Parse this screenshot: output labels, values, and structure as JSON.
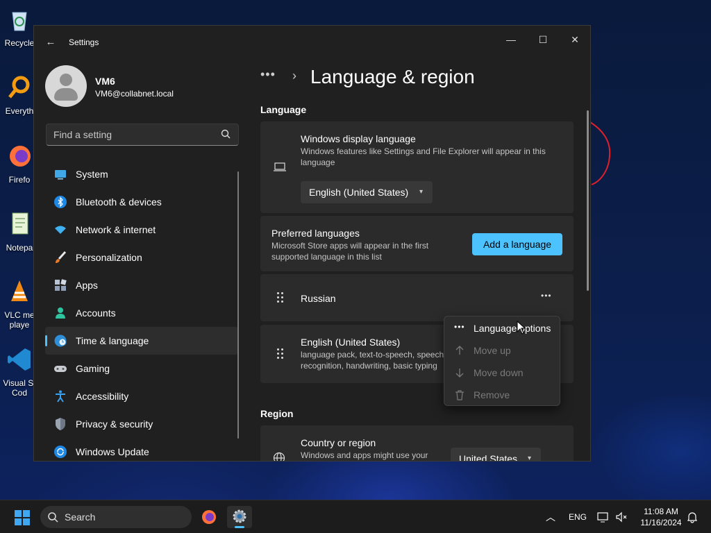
{
  "desktop": {
    "icons": [
      {
        "label": "Recycle"
      },
      {
        "label": "Everyth"
      },
      {
        "label": "Firefo"
      },
      {
        "label": "Notepa"
      },
      {
        "label": "VLC me"
      },
      {
        "label": "playe"
      },
      {
        "label": "Visual St"
      },
      {
        "label": "Cod"
      }
    ]
  },
  "window": {
    "title": "Settings",
    "controls": {
      "minimize": "—",
      "maximize": "☐",
      "close": "✕"
    }
  },
  "profile": {
    "name": "VM6",
    "email": "VM6@collabnet.local"
  },
  "search": {
    "placeholder": "Find a setting"
  },
  "sidebar": {
    "items": [
      {
        "label": "System",
        "icon": "system-icon"
      },
      {
        "label": "Bluetooth & devices",
        "icon": "bluetooth-icon"
      },
      {
        "label": "Network & internet",
        "icon": "network-icon"
      },
      {
        "label": "Personalization",
        "icon": "brush-icon"
      },
      {
        "label": "Apps",
        "icon": "apps-icon"
      },
      {
        "label": "Accounts",
        "icon": "accounts-icon"
      },
      {
        "label": "Time & language",
        "icon": "globe-icon",
        "active": true
      },
      {
        "label": "Gaming",
        "icon": "gamepad-icon"
      },
      {
        "label": "Accessibility",
        "icon": "accessibility-icon"
      },
      {
        "label": "Privacy & security",
        "icon": "shield-icon"
      },
      {
        "label": "Windows Update",
        "icon": "update-icon"
      }
    ]
  },
  "breadcrumb": {
    "more": "•••",
    "separator": "›",
    "title": "Language & region"
  },
  "language_section": {
    "title": "Language",
    "display_language": {
      "title": "Windows display language",
      "description": "Windows features like Settings and File Explorer will appear in this language",
      "value": "English (United States)"
    },
    "preferred": {
      "title": "Preferred languages",
      "description": "Microsoft Store apps will appear in the first supported language in this list",
      "button": "Add a language"
    },
    "languages": [
      {
        "name": "Russian",
        "details": ""
      },
      {
        "name": "English (United States)",
        "details": "language pack, text-to-speech, speech recognition, handwriting, basic typing"
      }
    ],
    "more_button": "•••"
  },
  "context_menu": {
    "items": [
      {
        "label": "Language options",
        "enabled": true
      },
      {
        "label": "Move up",
        "enabled": false
      },
      {
        "label": "Move down",
        "enabled": false
      },
      {
        "label": "Remove",
        "enabled": false
      }
    ]
  },
  "region_section": {
    "title": "Region",
    "country": {
      "title": "Country or region",
      "description": "Windows and apps might use your",
      "value": "United States"
    }
  },
  "taskbar": {
    "search_label": "Search",
    "language": "ENG",
    "time": "11:08 AM",
    "date": "11/16/2024"
  },
  "colors": {
    "accent": "#4cc2ff",
    "window_bg": "#202020",
    "card_bg": "#2b2b2b",
    "annotation": "#e0202a"
  }
}
